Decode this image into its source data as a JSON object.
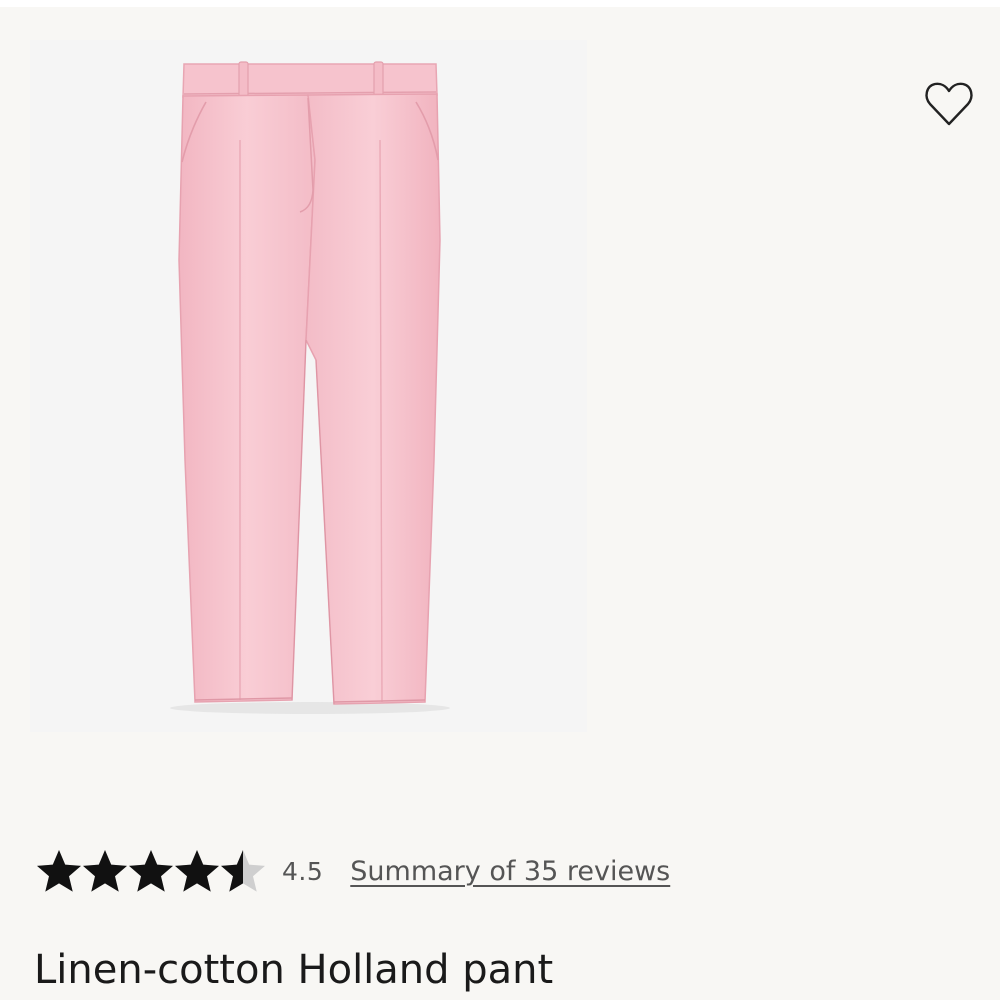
{
  "product": {
    "title": "Linen-cotton Holland pant",
    "image_alt": "Pink linen-cotton Holland pant",
    "image_color": "#f7c6cf"
  },
  "wishlist": {
    "icon": "heart-outline-icon"
  },
  "rating": {
    "value": 4.5,
    "value_label": "4.5",
    "max": 5,
    "reviews_link_label": "Summary of 35 reviews",
    "star_color": "#111111",
    "empty_star_color": "#cfcfcf"
  }
}
